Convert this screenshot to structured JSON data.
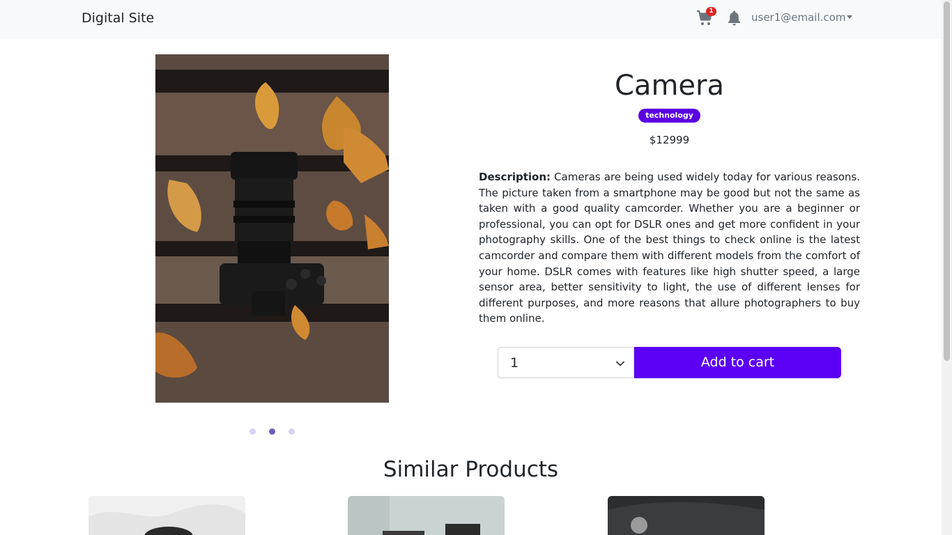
{
  "navbar": {
    "brand": "Digital Site",
    "cart_count": "1",
    "cart_icon": "cart-icon",
    "bell_icon": "bell-icon",
    "user_email": "user1@email.com"
  },
  "product": {
    "title": "Camera",
    "category": "technology",
    "price": "$12999",
    "description_label": "Description:",
    "description": "Cameras are being used widely today for various reasons. The picture taken from a smartphone may be good but not the same as taken with a good quality camcorder. Whether you are a beginner or professional, you can opt for DSLR ones and get more confident in your photography skills. One of the best things to check online is the latest camcorder and compare them with different models from the comfort of your home. DSLR comes with features like high shutter speed, a large sensor area, better sensitivity to light, the use of different lenses for different purposes, and more reasons that allure photographers to buy them online.",
    "quantity": "1",
    "add_to_cart": "Add to cart"
  },
  "carousel": {
    "active_index": 1,
    "slide_count": 3
  },
  "similar": {
    "title": "Similar Products"
  },
  "colors": {
    "accent": "#5b00f5",
    "badge": "#5b00e0",
    "cart_badge": "#e02424"
  }
}
